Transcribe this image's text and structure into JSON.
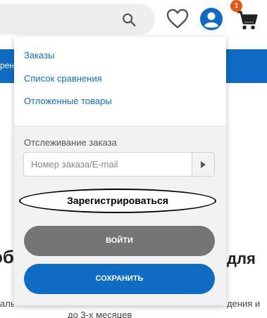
{
  "header": {
    "search_icon": "search-icon",
    "wishlist_icon": "heart-icon",
    "account_icon": "user-icon",
    "cart_icon": "cart-icon",
    "cart_count": "1",
    "accent_color": "#0f6bc4",
    "badge_color": "#e8560f"
  },
  "background": {
    "bar_text": "рен",
    "heading_left": "об",
    "heading_right": "для",
    "para_left": "алы",
    "para_right": "дения и",
    "para_bottom": "до 3-х месяцев"
  },
  "dropdown": {
    "links": [
      "Заказы",
      "Список сравнения",
      "Отложенные товары"
    ],
    "tracking_label": "Отслеживание заказа",
    "tracking_placeholder": "Номер заказа/E-mail",
    "tracking_value": "",
    "submit_icon": "play-icon",
    "register_label": "Зарегистрироваться",
    "login_label": "ВОЙТИ",
    "save_label": "СОХРАНИТЬ"
  }
}
